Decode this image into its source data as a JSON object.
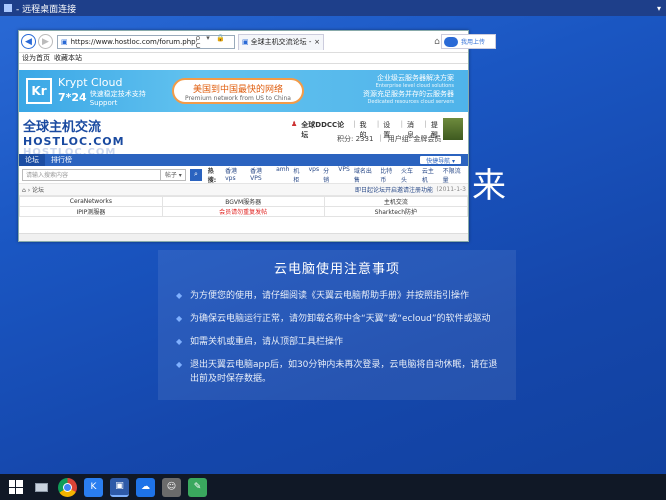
{
  "remote": {
    "title": "- 远程桌面连接",
    "big_char": "来"
  },
  "browser": {
    "url": "https://www.hostloc.com/forum.php",
    "addr_tools": "ρ ▾ 🔒 C",
    "tab_title": "全球主机交流论坛 - Power...",
    "favbar": [
      "设为首页",
      "收藏本站"
    ]
  },
  "banner": {
    "brand": "Krypt Cloud",
    "sub_big": "7*24",
    "sub_small1": "快速稳定技术支持",
    "sub_small2": "Support",
    "pill_main": "美国到中国最快的网络",
    "pill_sub": "Premium network from US to China",
    "right1": "企业级云服务器解决方案",
    "right1_en": "Enterprise level cloud solutions",
    "right2": "资源充足服务并存的云服务器",
    "right2_en": "Dedicated resources cloud servers"
  },
  "site": {
    "logo_cn": "全球主机交流",
    "logo_en": "HOSTLOC.COM",
    "logo_en2": "HOSTLOC.COM",
    "user": "全球DDCC论坛",
    "links": [
      "我的",
      "设置",
      "消息",
      "提醒",
      "退出"
    ],
    "score": "积分: 2331",
    "group": "用户组: 金牌会员"
  },
  "nav": {
    "items": [
      "论坛",
      "排行榜"
    ],
    "quick": "快捷导航 ▾"
  },
  "search": {
    "placeholder": "请输入搜索内容",
    "select": "帖子 ▾",
    "hot_label": "热搜:",
    "hot": [
      "香港vps",
      "香港VPS",
      "amh",
      "机柜",
      "vps",
      "分销",
      "VPS",
      "域名出售",
      "比特币",
      "火车头",
      "云主机",
      "不限流量"
    ]
  },
  "crumb": {
    "path": "⌂ › 论坛",
    "announce": "即日起论坛开启邀请注册功能",
    "date": "(2011-1-3"
  },
  "links_table": [
    [
      "CeraNetworks",
      "BGVM服务器",
      "主机交流"
    ],
    [
      "IPIP测服器",
      "会员请勿重复发帖",
      "Sharktech防护"
    ]
  ],
  "float_button": "我用上传",
  "notice": {
    "title": "云电脑使用注意事项",
    "items": [
      "为方便您的使用，请仔细阅读《天翼云电脑帮助手册》并按照指引操作",
      "为确保云电脑运行正常，请勿卸载名称中含“天翼”或“ecloud”的软件或驱动",
      "如需关机或重启，请从顶部工具栏操作",
      "退出天翼云电脑app后，如30分钟内未再次登录，云电脑将自动休眠，请在退出前及时保存数据。"
    ]
  },
  "taskbar": [
    "windows-start",
    "chrome",
    "krypt",
    "remote-desktop",
    "ecloud",
    "people",
    "notes"
  ]
}
